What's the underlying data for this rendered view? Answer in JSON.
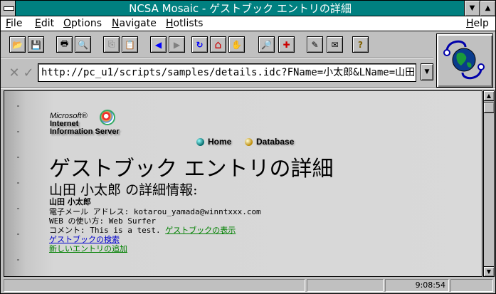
{
  "window": {
    "title": "NCSA Mosaic - ゲストブック エントリの詳細",
    "minimize_glyph": "▼",
    "maximize_glyph": "▲"
  },
  "menu": {
    "items": [
      {
        "first": "F",
        "rest": "ile"
      },
      {
        "first": "E",
        "rest": "dit"
      },
      {
        "first": "O",
        "rest": "ptions"
      },
      {
        "first": "N",
        "rest": "avigate"
      },
      {
        "first": "H",
        "rest": "otlists"
      }
    ],
    "help": {
      "first": "H",
      "rest": "elp"
    }
  },
  "toolbar": {
    "icons": [
      "open-folder-icon",
      "save-icon",
      "print-icon",
      "print-preview-icon",
      "copy-icon",
      "paste-icon",
      "back-icon",
      "forward-icon",
      "reload-icon",
      "home-icon",
      "stop-hand-icon",
      "find-icon",
      "add-hotlist-icon",
      "annotate-icon",
      "mail-icon",
      "help-icon"
    ],
    "glyphs": [
      "📂",
      "💾",
      "🖶",
      "🔍",
      "⎘",
      "📋",
      "◀",
      "▶",
      "↻",
      "⌂",
      "✋",
      "🔎",
      "✚",
      "✎",
      "✉",
      "?"
    ],
    "colors": {
      "back": "#0000ff",
      "reload": "#0000ff",
      "home": "#cc0000",
      "disabled": "#808080"
    }
  },
  "urlbar": {
    "cancel_glyph": "✕",
    "ok_glyph": "✓",
    "url": "http://pc_u1/scripts/samples/details.idc?FName=小太郎&LName=山田",
    "dropdown_glyph": "▼"
  },
  "page": {
    "logo": {
      "line1": "Microsoft®",
      "line2": "Internet",
      "line3": "Information Server"
    },
    "nav": {
      "home": "Home",
      "database": "Database"
    },
    "heading": "ゲストブック エントリの詳細",
    "subheading": "山田 小太郎 の詳細情報:",
    "name": "山田 小太郎",
    "email_label": "電子メール アドレス: ",
    "email_value": "kotarou_yamada@winntxxx.com",
    "web_label": "WEB の使い方: ",
    "web_value": "Web Surfer",
    "comment_label": "コメント: ",
    "comment_value": "This is a test.",
    "link_show": "ゲストブックの表示",
    "link_search": "ゲストブックの検索",
    "link_add": "新しいエントリの追加"
  },
  "scrollbar": {
    "up_glyph": "▲",
    "down_glyph": "▼"
  },
  "status": {
    "clock": "9:08:54"
  }
}
